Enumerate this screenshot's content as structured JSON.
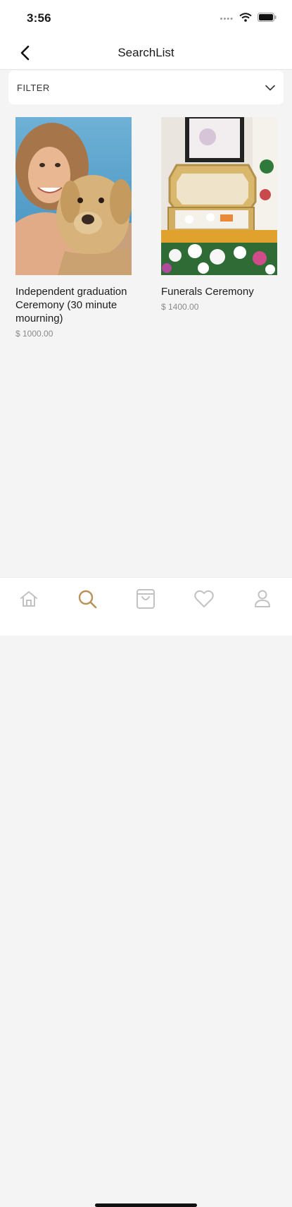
{
  "status_bar": {
    "time": "3:56"
  },
  "nav": {
    "title": "SearchList"
  },
  "filter": {
    "label": "FILTER"
  },
  "products": [
    {
      "title": "Independent graduation Ceremony (30 minute mourning)",
      "price": "$ 1000.00"
    },
    {
      "title": "Funerals Ceremony",
      "price": "$ 1400.00"
    }
  ],
  "tab_bar": {
    "items": [
      "home-icon",
      "search-icon",
      "bag-icon",
      "heart-icon",
      "profile-icon"
    ],
    "active": "search-icon",
    "active_color": "#b8925a",
    "inactive_color": "#c2c2c2"
  }
}
